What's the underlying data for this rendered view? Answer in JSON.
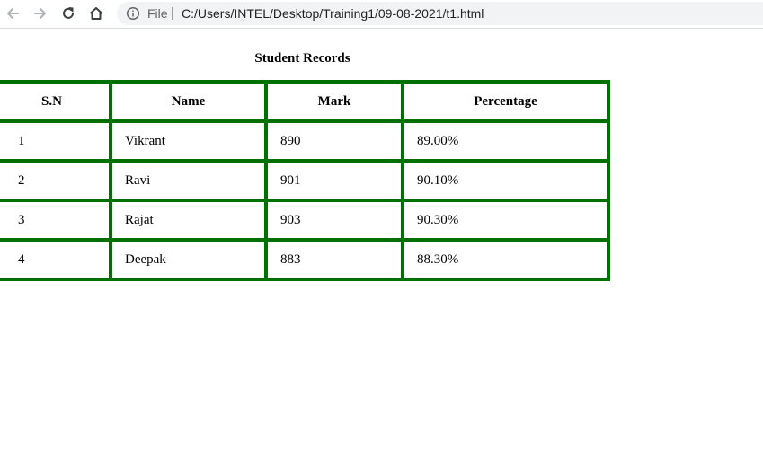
{
  "browser": {
    "scheme_label": "File",
    "url": "C:/Users/INTEL/Desktop/Training1/09-08-2021/t1.html",
    "icons": [
      "back-arrow-icon",
      "forward-arrow-icon",
      "reload-icon",
      "home-icon",
      "info-icon"
    ]
  },
  "page": {
    "caption": "Student Records",
    "headers": [
      "S.N",
      "Name",
      "Mark",
      "Percentage"
    ],
    "rows": [
      [
        "1",
        "Vikrant",
        "890",
        "89.00%"
      ],
      [
        "2",
        "Ravi",
        "901",
        "90.10%"
      ],
      [
        "3",
        "Rajat",
        "903",
        "90.30%"
      ],
      [
        "4",
        "Deepak",
        "883",
        "88.30%"
      ]
    ]
  },
  "colors": {
    "table_border": "#007000",
    "omnibox_bg": "#f1f3f4"
  }
}
